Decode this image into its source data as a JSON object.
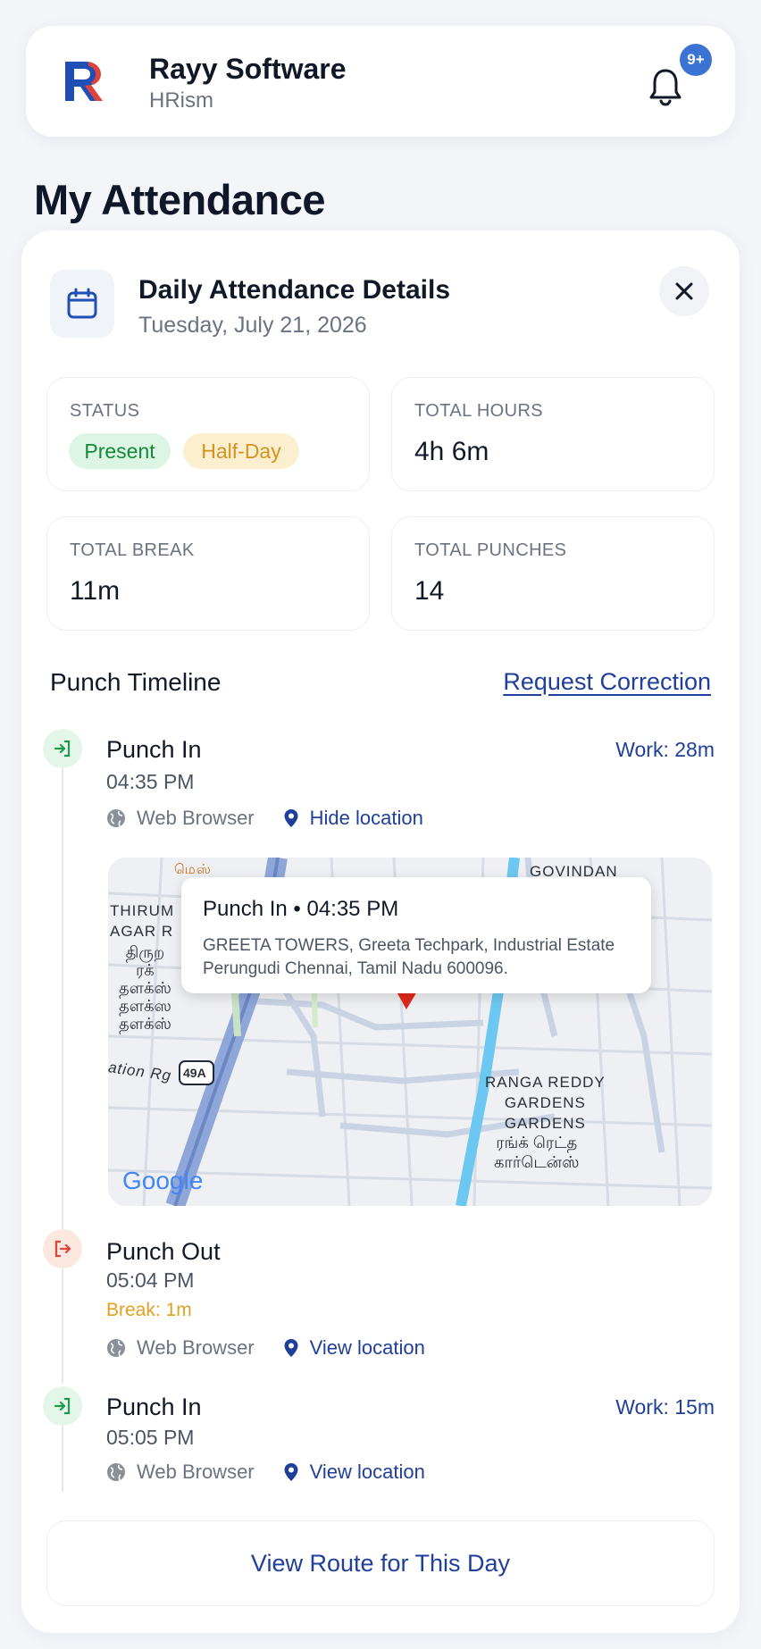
{
  "header": {
    "app_name": "Rayy Software",
    "app_sub": "HRism",
    "notification_badge": "9+"
  },
  "page": {
    "title": "My Attendance"
  },
  "details": {
    "title": "Daily Attendance Details",
    "date": "Tuesday, July 21, 2026"
  },
  "stats": {
    "status_label": "STATUS",
    "status_present": "Present",
    "status_half": "Half-Day",
    "hours_label": "TOTAL HOURS",
    "hours_value": "4h 6m",
    "break_label": "TOTAL BREAK",
    "break_value": "11m",
    "punches_label": "TOTAL PUNCHES",
    "punches_value": "14"
  },
  "timeline": {
    "title": "Punch Timeline",
    "request_correction": "Request Correction",
    "events": [
      {
        "type": "Punch In",
        "time": "04:35 PM",
        "work": "Work: 28m",
        "source": "Web Browser",
        "location_link": "Hide location"
      },
      {
        "type": "Punch Out",
        "time": "05:04 PM",
        "break": "Break: 1m",
        "source": "Web Browser",
        "location_link": "View location"
      },
      {
        "type": "Punch In",
        "time": "05:05 PM",
        "work": "Work: 15m",
        "source": "Web Browser",
        "location_link": "View location"
      }
    ]
  },
  "map": {
    "popup_title": "Punch In • 04:35 PM",
    "popup_address": "GREETA TOWERS, Greeta Techpark, Industrial Estate  Perungudi  Chennai,  Tamil Nadu 600096.",
    "labels": {
      "govindan": "GOVINDAN",
      "thirum": "THIRUM\nAGAR R",
      "tamil_left": "திருற\nரக்\nதளக்ஸ்\nதளக்ஸ\nதளக்ஸ்",
      "tamil_top": "மெஸ்",
      "ranga": "RANGA REDDY\nGARDENS\nGARDENS",
      "ranga_tamil": "ரங்க் ரெட்த\nகார்டென்ஸ்",
      "station": "ation Rg",
      "highway": "49A",
      "google": "Google"
    }
  },
  "route_button": "View Route for This Day",
  "colors": {
    "accent": "#1f3f9a",
    "present_bg": "#dcf5e4",
    "present_fg": "#16883a",
    "half_bg": "#fcefd0",
    "half_fg": "#d4931f",
    "break": "#e3a020",
    "badge": "#3b73d4"
  }
}
